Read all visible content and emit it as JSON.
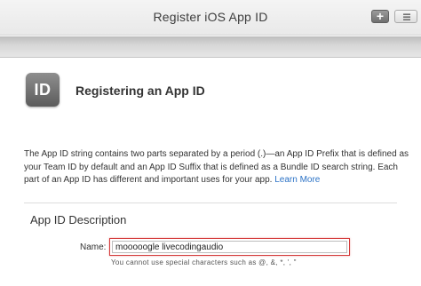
{
  "window": {
    "title": "Register iOS App ID",
    "add_label": "+"
  },
  "header": {
    "icon_text": "ID",
    "title": "Registering an App ID"
  },
  "description": {
    "text": "The App ID string contains two parts separated by a period (.)—an App ID Prefix that is defined as your Team ID by default and an App ID Suffix that is defined as a Bundle ID search string. Each part of an App ID has different and important uses for your app. ",
    "link": "Learn More"
  },
  "form": {
    "section_title": "App ID Description",
    "name_label": "Name:",
    "name_value": "mooooogle livecodingaudio",
    "hint": "You cannot use special characters such as @, &, *, ', \""
  },
  "colors": {
    "link": "#2b72c6",
    "error_border": "#d43b3b"
  },
  "icons": [
    "add-icon",
    "filter-icon",
    "app-id-icon"
  ]
}
